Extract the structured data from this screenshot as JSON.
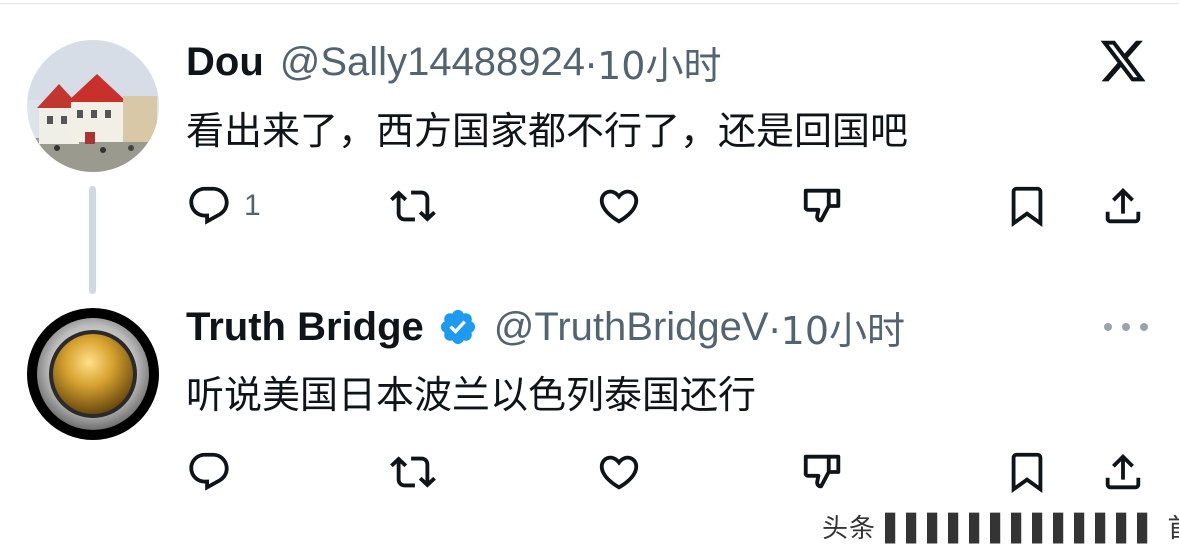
{
  "tweets": [
    {
      "name": "Dou",
      "handle": "@Sally14488924",
      "time": "·10小时",
      "text": "看出来了，西方国家都不行了，还是回国吧",
      "reply_count": "1",
      "avatar": "house-photo-avatar"
    },
    {
      "name": "Truth Bridge",
      "handle": "@TruthBridgeV",
      "time": "·10小时",
      "text": "听说美国日本波兰以色列泰国还行",
      "reply_count": "",
      "verified": true,
      "avatar": "gold-button-avatar"
    }
  ],
  "icons": [
    "x-logo-icon",
    "reply-icon",
    "retweet-icon",
    "like-icon",
    "dislike-icon",
    "bookmark-icon",
    "share-icon",
    "more-icon",
    "verified-badge-icon"
  ],
  "colors": {
    "text": "#0f1419",
    "secondary": "#536471",
    "verified": "#1d9bf0",
    "thread_line": "#cfd9de"
  },
  "watermark": "头条 ▌▌▌▌▌▌▌▌▌▌▌▌▌ 首"
}
